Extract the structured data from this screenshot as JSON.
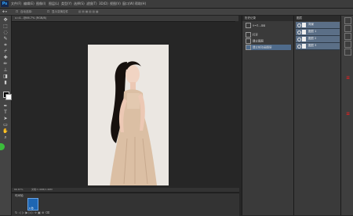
{
  "app": {
    "logo": "Ps"
  },
  "menu": [
    "文件(F)",
    "编辑(E)",
    "图像(I)",
    "图层(L)",
    "类型(Y)",
    "选择(S)",
    "滤镜(T)",
    "3D(D)",
    "视图(V)",
    "窗口(W)",
    "帮助(H)"
  ],
  "options": {
    "auto_select_label": "自动选择:",
    "show_transform_label": "显示变换控件"
  },
  "document": {
    "tab_title": "u=4...@66.7% (RGB/8)",
    "zoom": "66.67%",
    "status": "文档:1.46M/1.46M"
  },
  "timeline": {
    "label": "时间轴",
    "thumb": "0 秒"
  },
  "history": {
    "title": "历史记录",
    "source": "u=2...jpg",
    "items": [
      "打开",
      "建立图层",
      "建立帧动画图层"
    ]
  },
  "layers": {
    "title": "图层",
    "items": [
      {
        "name": "背景",
        "size": "100%"
      },
      {
        "name": "图层 1",
        "size": "100%"
      },
      {
        "name": "图层 2",
        "size": "100%"
      },
      {
        "name": "图层 3",
        "size": "100%"
      }
    ]
  },
  "colors": {
    "accent": "#1e66b2",
    "layer_selected": "#5b6f87",
    "marker": "#dd2222"
  }
}
